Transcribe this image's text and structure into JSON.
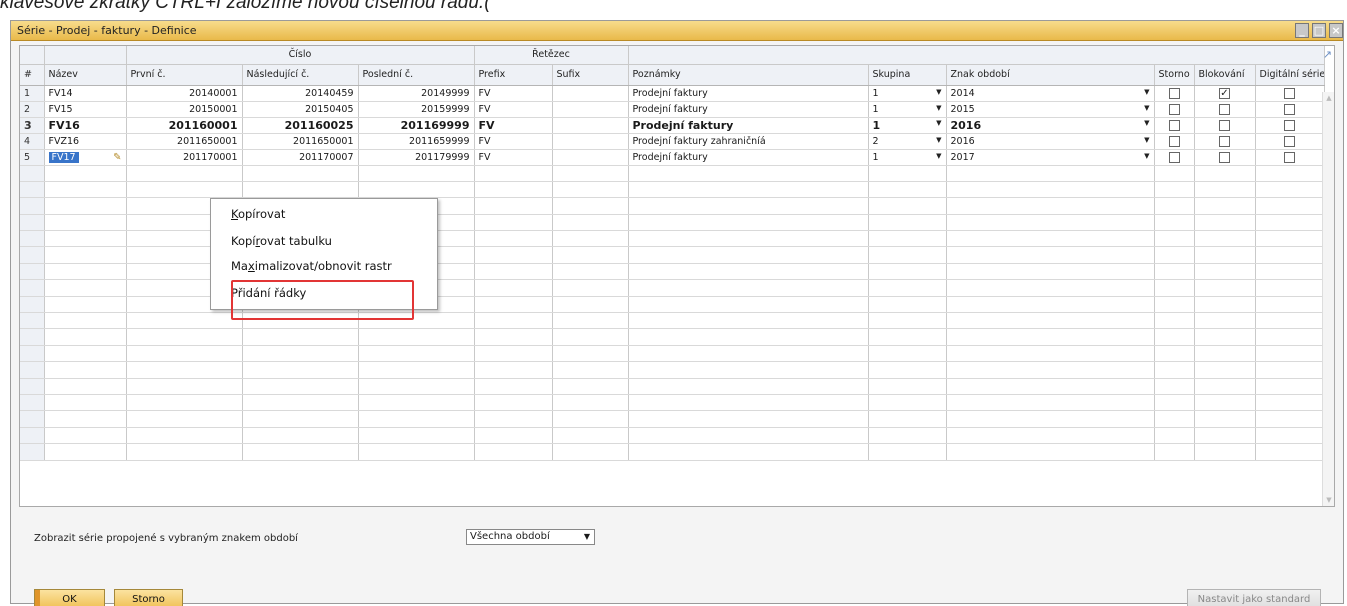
{
  "caption": "klávesové zkratky CTRL+I založíme novou číselnou řadu.(",
  "window": {
    "title": "Série - Prodej - faktury - Definice"
  },
  "columns": {
    "group_cislo": "Číslo",
    "group_retezec": "Řetězec",
    "rownum": "#",
    "name": "Název",
    "first": "První č.",
    "next": "Následující č.",
    "last": "Poslední č.",
    "prefix": "Prefix",
    "suffix": "Sufix",
    "remarks": "Poznámky",
    "group": "Skupina",
    "period": "Znak období",
    "storno": "Storno",
    "blocked": "Blokování",
    "digital": "Digitální série"
  },
  "rows": [
    {
      "num": "1",
      "name": "FV14",
      "first": "20140001",
      "next": "20140459",
      "last": "20149999",
      "prefix": "FV",
      "suffix": "",
      "remarks": "Prodejní faktury",
      "group": "1",
      "period": "2014",
      "storno": false,
      "blocked": true,
      "digital": false
    },
    {
      "num": "2",
      "name": "FV15",
      "first": "20150001",
      "next": "20150405",
      "last": "20159999",
      "prefix": "FV",
      "suffix": "",
      "remarks": "Prodejní faktury",
      "group": "1",
      "period": "2015",
      "storno": false,
      "blocked": false,
      "digital": false
    },
    {
      "num": "3",
      "name": "FV16",
      "first": "201160001",
      "next": "201160025",
      "last": "201169999",
      "prefix": "FV",
      "suffix": "",
      "remarks": "Prodejní faktury",
      "group": "1",
      "period": "2016",
      "storno": false,
      "blocked": false,
      "digital": false
    },
    {
      "num": "4",
      "name": "FVZ16",
      "first": "2011650001",
      "next": "2011650001",
      "last": "2011659999",
      "prefix": "FV",
      "suffix": "",
      "remarks": "Prodejní faktury zahraničníá",
      "group": "2",
      "period": "2016",
      "storno": false,
      "blocked": false,
      "digital": false
    },
    {
      "num": "5",
      "name": "FV17",
      "first": "201170001",
      "next": "201170007",
      "last": "201179999",
      "prefix": "FV",
      "suffix": "",
      "remarks": "Prodejní faktury",
      "group": "1",
      "period": "2017",
      "storno": false,
      "blocked": false,
      "digital": false
    }
  ],
  "context_menu": {
    "copy_label": "Kopírovat",
    "copy_table_label": "Kopírovat tabulku",
    "maximize_label": "Maximalizovat/obnovit rastr",
    "add_row_label": "Přidání řádky"
  },
  "footer": {
    "filter_label": "Zobrazit série propojené s vybraným znakem období",
    "filter_value": "Všechna období",
    "ok_label": "OK",
    "cancel_label": "Storno",
    "default_label": "Nastavit jako standard"
  },
  "icons": {
    "checked": "check-icon",
    "dropdown": "triangle-down-icon",
    "edit": "pencil-icon",
    "expand": "expand-arrow-icon"
  },
  "colors": {
    "title_bar": "#e9b94a",
    "selection": "#3874c9",
    "highlight_box": "#e23535",
    "ok_button": "#efbd4e"
  }
}
